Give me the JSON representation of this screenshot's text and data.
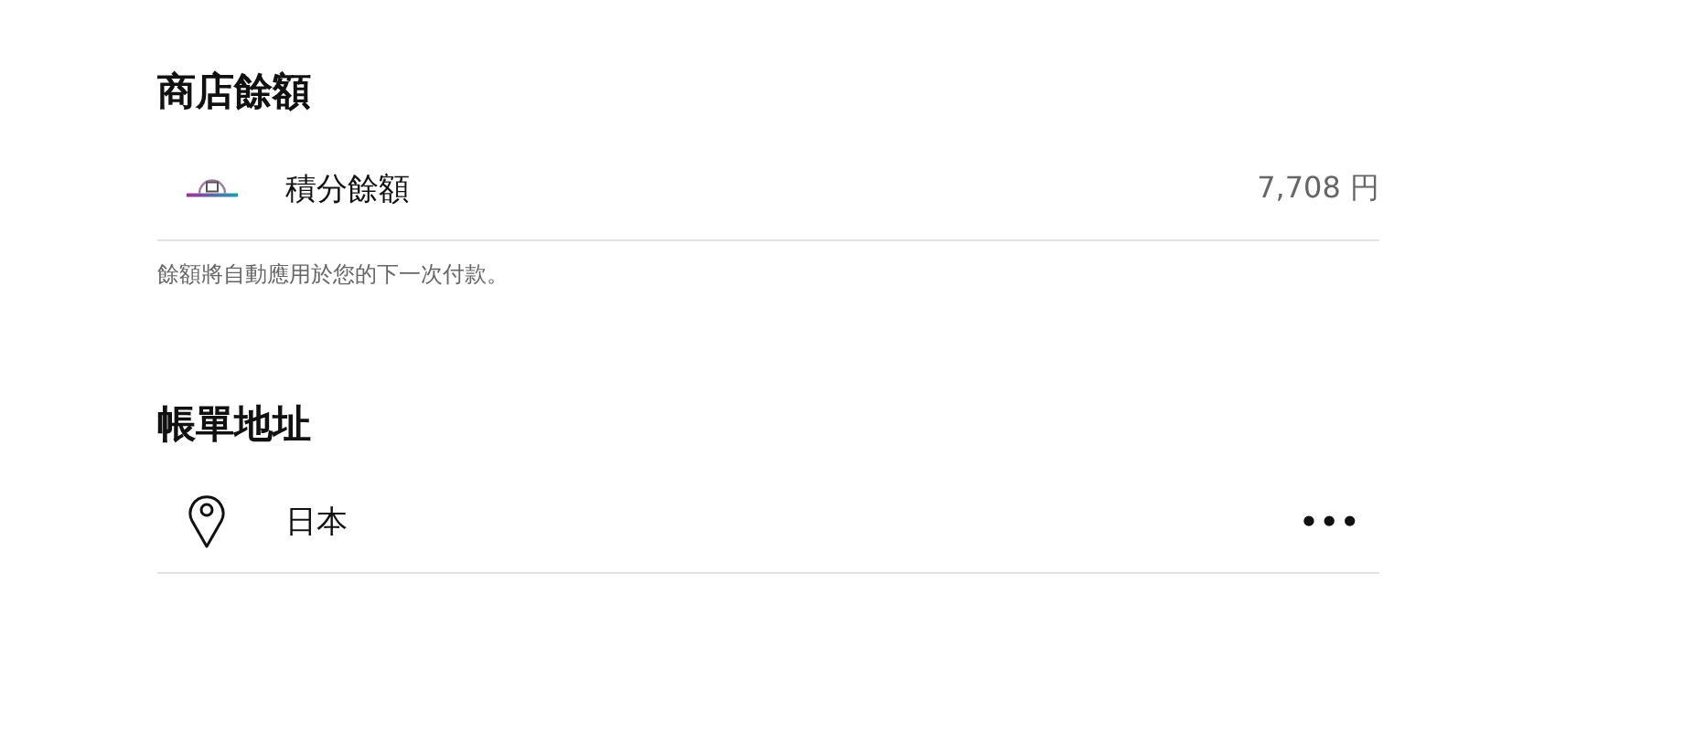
{
  "store_balance": {
    "heading": "商店餘額",
    "row": {
      "label": "積分餘額",
      "amount": "7,708 円"
    },
    "note": "餘額將自動應用於您的下一次付款。"
  },
  "billing_address": {
    "heading": "帳單地址",
    "row": {
      "label": "日本",
      "menu": "•••"
    }
  }
}
